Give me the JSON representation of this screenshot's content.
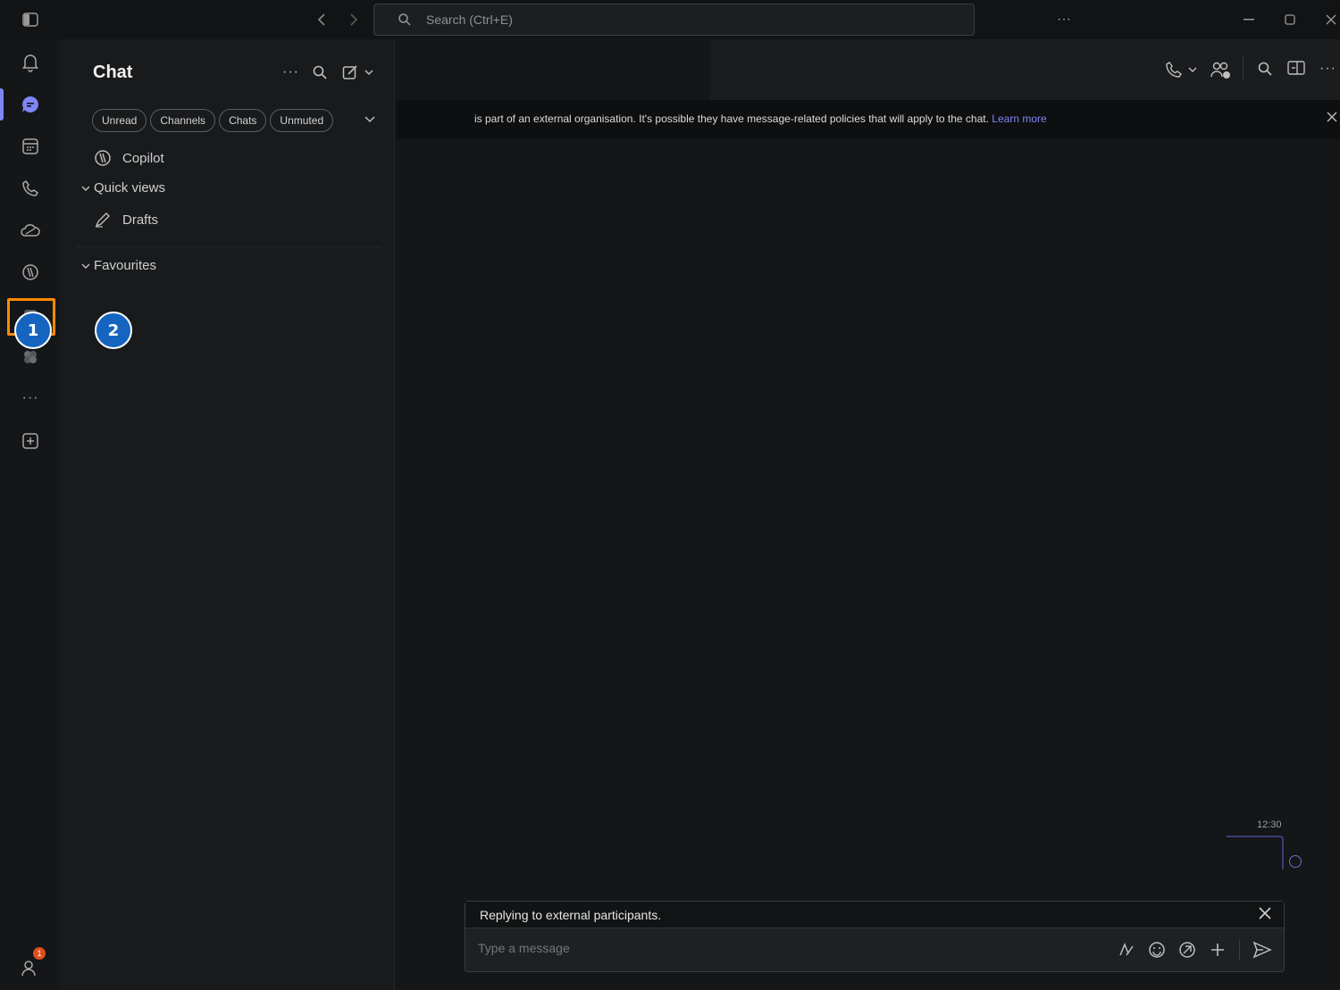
{
  "titlebar": {
    "search_placeholder": "Search (Ctrl+E)",
    "more": "···"
  },
  "rail": {
    "items": [
      {
        "name": "activity"
      },
      {
        "name": "chat"
      },
      {
        "name": "calendar"
      },
      {
        "name": "calls"
      },
      {
        "name": "onedrive"
      },
      {
        "name": "copilot"
      },
      {
        "name": "app-highlighted"
      },
      {
        "name": "apps"
      },
      {
        "name": "more-apps"
      },
      {
        "name": "add-app"
      }
    ],
    "more_label": "···",
    "notification_count": "1",
    "step_labels": [
      "1",
      "2"
    ]
  },
  "chat_list": {
    "title": "Chat",
    "more": "···",
    "filters": [
      "Unread",
      "Channels",
      "Chats",
      "Unmuted"
    ],
    "copilot_label": "Copilot",
    "quick_views_label": "Quick views",
    "drafts_label": "Drafts",
    "favourites_label": "Favourites"
  },
  "main": {
    "banner_text": "is part of an external organisation. It's possible they have message-related policies that will apply to the chat.",
    "banner_link": "Learn more",
    "message_time": "12:30",
    "header_more": "···",
    "composer": {
      "reply_notice": "Replying to external participants.",
      "placeholder": "Type a message"
    }
  },
  "colors": {
    "accent": "#7f85f5",
    "highlight": "#ff8a00",
    "step_badge": "#1565c0",
    "notification": "#e04e1e"
  }
}
